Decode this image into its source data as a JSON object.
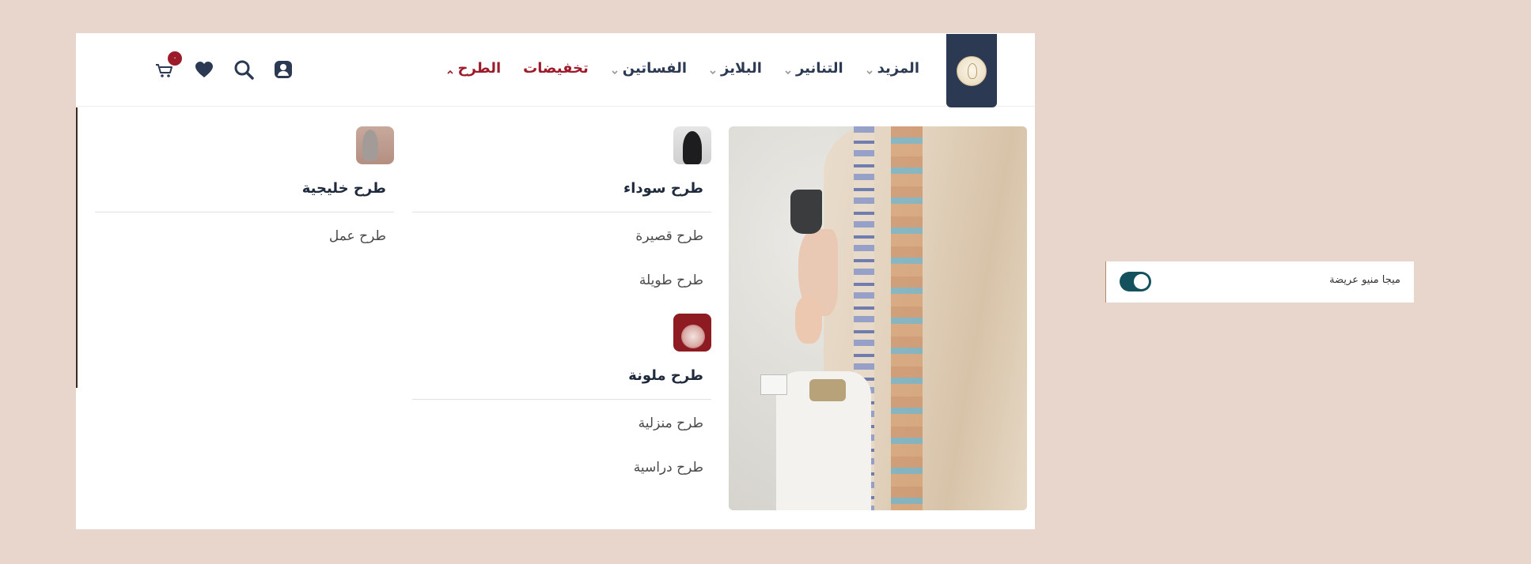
{
  "nav": {
    "items": [
      {
        "label": "الطرح",
        "state": "active",
        "has_dropdown": true
      },
      {
        "label": "تخفيضات",
        "state": "sale",
        "has_dropdown": false
      },
      {
        "label": "الفساتين",
        "state": "normal",
        "has_dropdown": true
      },
      {
        "label": "البلايز",
        "state": "normal",
        "has_dropdown": true
      },
      {
        "label": "التنانير",
        "state": "normal",
        "has_dropdown": true
      },
      {
        "label": "المزيد",
        "state": "normal",
        "has_dropdown": true
      }
    ]
  },
  "header_icons": {
    "account": "user-icon",
    "search": "search-icon",
    "wishlist": "heart-icon",
    "cart": "cart-icon",
    "cart_count": "٠"
  },
  "mega_menu": {
    "columns": [
      {
        "groups": [
          {
            "title": "طرح سوداء",
            "thumb": "black-hijab-thumbnail",
            "links": [
              "طرح قصيرة",
              "طرح طويلة"
            ]
          },
          {
            "title": "طرح ملونة",
            "thumb": "colored-hijab-thumbnail",
            "links": [
              "طرح منزلية",
              "طرح دراسية"
            ]
          }
        ]
      },
      {
        "groups": [
          {
            "title": "طرح خليجية",
            "thumb": "gulf-hijab-thumbnail",
            "links": [
              "طرح عمل"
            ]
          }
        ]
      }
    ]
  },
  "side_panel": {
    "label": "ميجا منيو عريضة",
    "toggle_on": true
  },
  "colors": {
    "background": "#e8d5cb",
    "navy": "#2b3a52",
    "accent_red": "#9c1b2a",
    "toggle": "#13525c"
  }
}
